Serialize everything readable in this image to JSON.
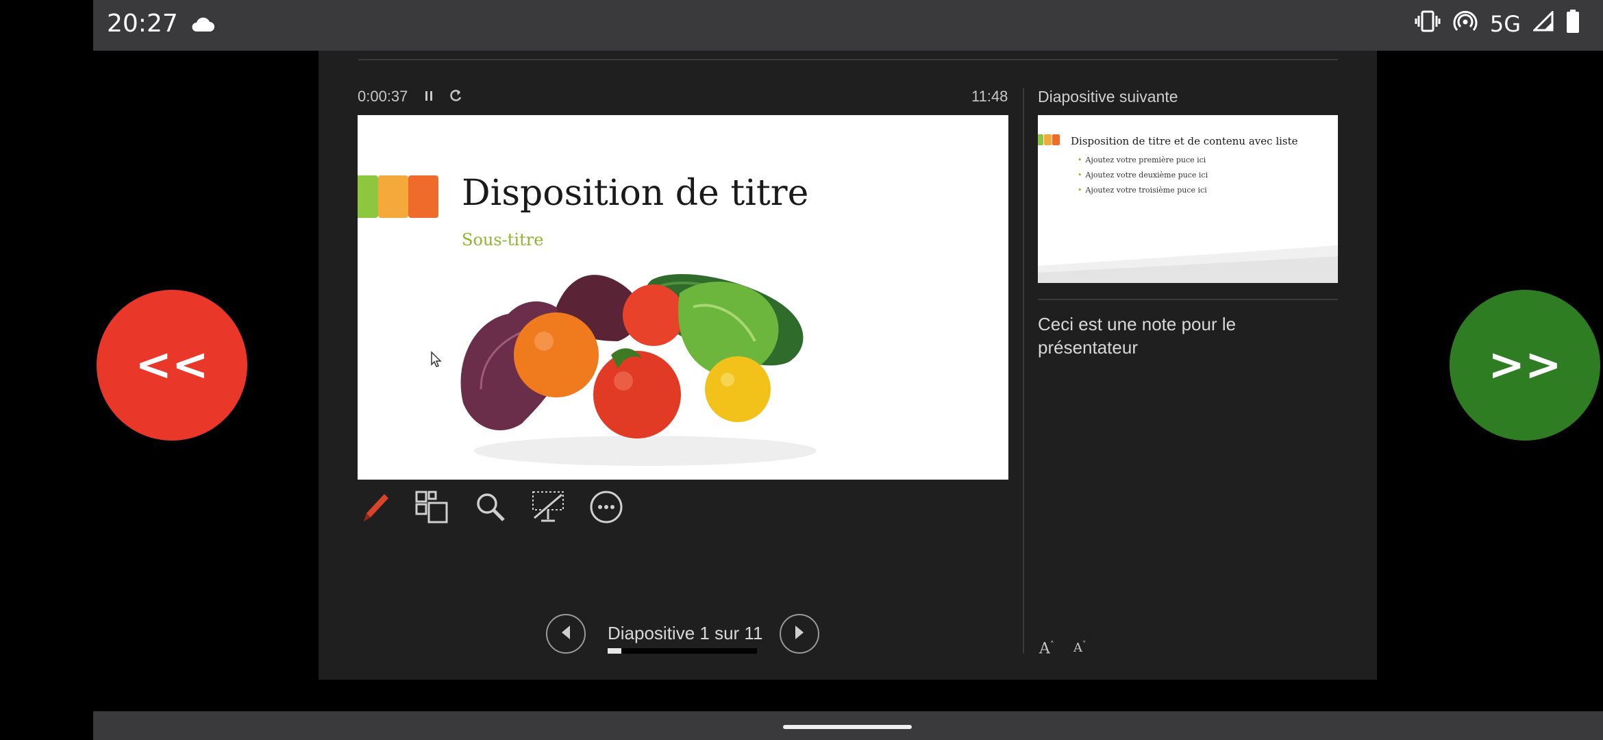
{
  "status_bar": {
    "time": "20:27",
    "icons": [
      "cloud-icon",
      "vibrate-icon",
      "hotspot-icon",
      "signal-icon",
      "battery-icon"
    ],
    "network": "5G"
  },
  "presenter": {
    "timer": "0:00:37",
    "clock": "11:48",
    "current_slide": {
      "title": "Disposition de titre",
      "subtitle": "Sous-titre",
      "accent_colors": [
        "#8dc63f",
        "#f5a93a",
        "#ef6b2c"
      ]
    },
    "toolbar": [
      "pen-icon",
      "all-slides-icon",
      "zoom-icon",
      "black-screen-icon",
      "more-options-icon"
    ],
    "navigation": {
      "counter": "Diapositive 1 sur 11",
      "progress": 0.09
    },
    "next_slide": {
      "label": "Diapositive suivante",
      "title": "Disposition de titre et de contenu avec liste",
      "bullets": [
        "Ajoutez votre première puce ici",
        "Ajoutez votre deuxième puce ici",
        "Ajoutez votre troisième puce ici"
      ]
    },
    "notes": "Ceci est une note pour le présentateur",
    "font_controls": {
      "increase": "A",
      "decrease": "A"
    }
  },
  "overlay": {
    "back_label": "<<",
    "back_color": "#e9372a",
    "forward_label": ">>",
    "forward_color": "#2e7d22"
  }
}
